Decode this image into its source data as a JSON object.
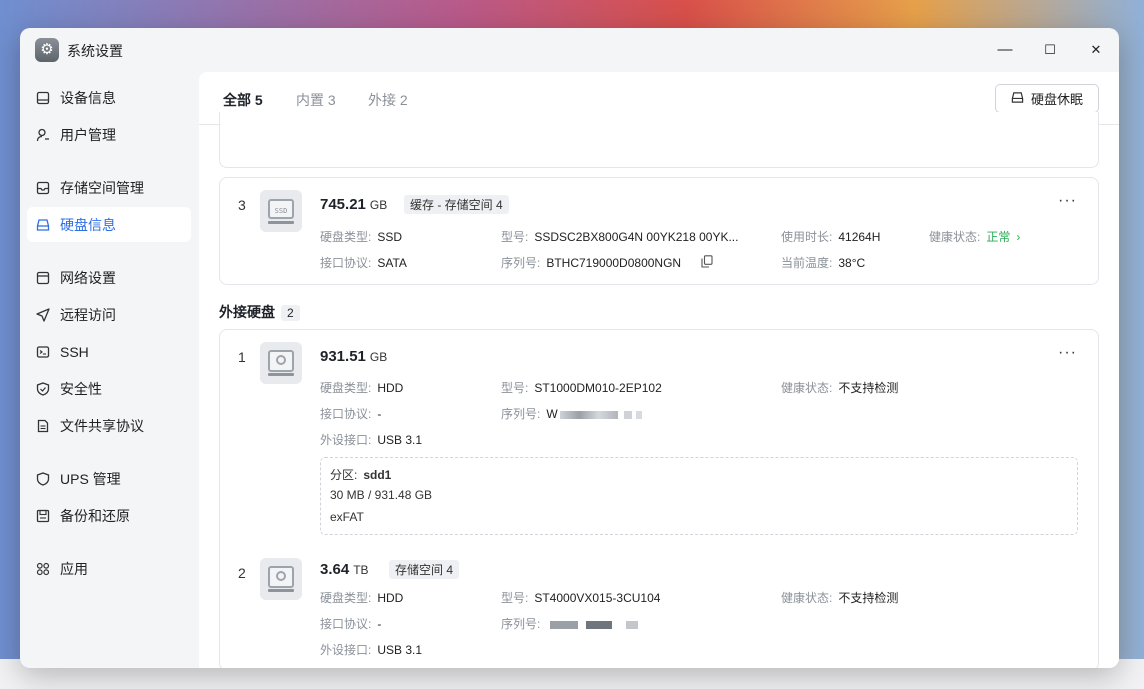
{
  "window": {
    "title": "系统设置",
    "minimize_glyph": "—",
    "maximize_glyph": "☐",
    "close_glyph": "✕"
  },
  "sidebar": {
    "items": [
      {
        "label": "设备信息",
        "icon": "device-icon"
      },
      {
        "label": "用户管理",
        "icon": "user-icon"
      },
      {
        "label": "存储空间管理",
        "icon": "storage-icon"
      },
      {
        "label": "硬盘信息",
        "icon": "disk-icon",
        "active": true
      },
      {
        "label": "网络设置",
        "icon": "network-icon"
      },
      {
        "label": "远程访问",
        "icon": "send-icon"
      },
      {
        "label": "SSH",
        "icon": "terminal-icon"
      },
      {
        "label": "安全性",
        "icon": "shield-check-icon"
      },
      {
        "label": "文件共享协议",
        "icon": "document-icon"
      },
      {
        "label": "UPS 管理",
        "icon": "shield-icon"
      },
      {
        "label": "备份和还原",
        "icon": "backup-icon"
      },
      {
        "label": "应用",
        "icon": "apps-icon"
      }
    ]
  },
  "tabs": [
    {
      "label": "全部 5",
      "active": true
    },
    {
      "label": "内置 3"
    },
    {
      "label": "外接 2"
    }
  ],
  "sleep_button": {
    "label": "硬盘休眠"
  },
  "labels": {
    "disk_type": "硬盘类型:",
    "model": "型号:",
    "usage_time": "使用时长:",
    "health": "健康状态:",
    "interface": "接口协议:",
    "serial": "序列号:",
    "temperature": "当前温度:",
    "external_port": "外设接口:",
    "partition": "分区:"
  },
  "internal_disk": {
    "index": "3",
    "icon_text": "SSD",
    "capacity": "745.21",
    "unit": "GB",
    "tag": "缓存 - 存储空间 4",
    "disk_type": "SSD",
    "model": "SSDSC2BX800G4N 00YK218 00YK...",
    "usage_time": "41264H",
    "health": "正常",
    "interface": "SATA",
    "serial": "BTHC719000D0800NGN",
    "temperature": "38°C"
  },
  "external_section": {
    "title": "外接硬盘",
    "count": "2"
  },
  "external_disks": [
    {
      "index": "1",
      "capacity": "931.51",
      "unit": "GB",
      "disk_type": "HDD",
      "model": "ST1000DM010-2EP102",
      "health": "不支持检测",
      "interface": "-",
      "serial_prefix": "W",
      "external_port": "USB 3.1",
      "partition": {
        "name": "sdd1",
        "usage": "30 MB / 931.48 GB",
        "fs": "exFAT"
      }
    },
    {
      "index": "2",
      "capacity": "3.64",
      "unit": "TB",
      "tag": "存储空间 4",
      "disk_type": "HDD",
      "model": "ST4000VX015-3CU104",
      "health": "不支持检测",
      "interface": "-",
      "external_port": "USB 3.1"
    }
  ]
}
